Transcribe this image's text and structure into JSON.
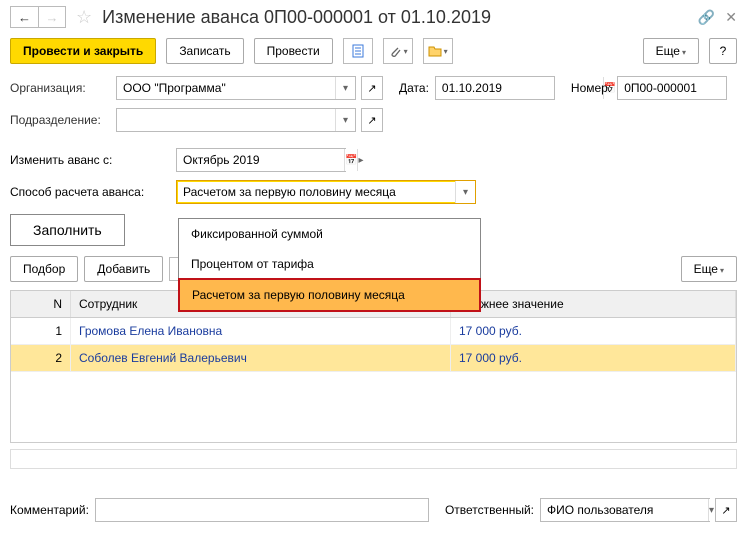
{
  "title": "Изменение аванса 0П00-000001 от 01.10.2019",
  "nav": {
    "back": "←",
    "forward": "→",
    "star": "☆"
  },
  "toolbar": {
    "post_close": "Провести и закрыть",
    "save": "Записать",
    "post": "Провести",
    "more": "Еще",
    "help": "?"
  },
  "fields": {
    "org_label": "Организация:",
    "org_value": "ООО \"Программа\"",
    "date_label": "Дата:",
    "date_value": "01.10.2019",
    "number_label": "Номер:",
    "number_value": "0П00-000001",
    "dept_label": "Подразделение:",
    "dept_value": "",
    "from_label": "Изменить аванс с:",
    "from_value": "Октябрь 2019",
    "method_label": "Способ расчета аванса:",
    "method_value": "Расчетом за первую половину месяца"
  },
  "dropdown": {
    "items": [
      "Фиксированной суммой",
      "Процентом от тарифа",
      "Расчетом за первую половину месяца"
    ]
  },
  "fill_button": "Заполнить",
  "table_toolbar": {
    "pick": "Подбор",
    "add": "Добавить",
    "more": "Еще"
  },
  "grid": {
    "cols": {
      "n": "N",
      "emp": "Сотрудник",
      "prev": "Прежнее значение"
    },
    "rows": [
      {
        "n": "1",
        "emp": "Громова Елена Ивановна",
        "prev": "17 000 руб."
      },
      {
        "n": "2",
        "emp": "Соболев Евгений Валерьевич",
        "prev": "17 000 руб."
      }
    ]
  },
  "footer": {
    "comment_label": "Комментарий:",
    "comment_value": "",
    "resp_label": "Ответственный:",
    "resp_value": "ФИО пользователя"
  }
}
